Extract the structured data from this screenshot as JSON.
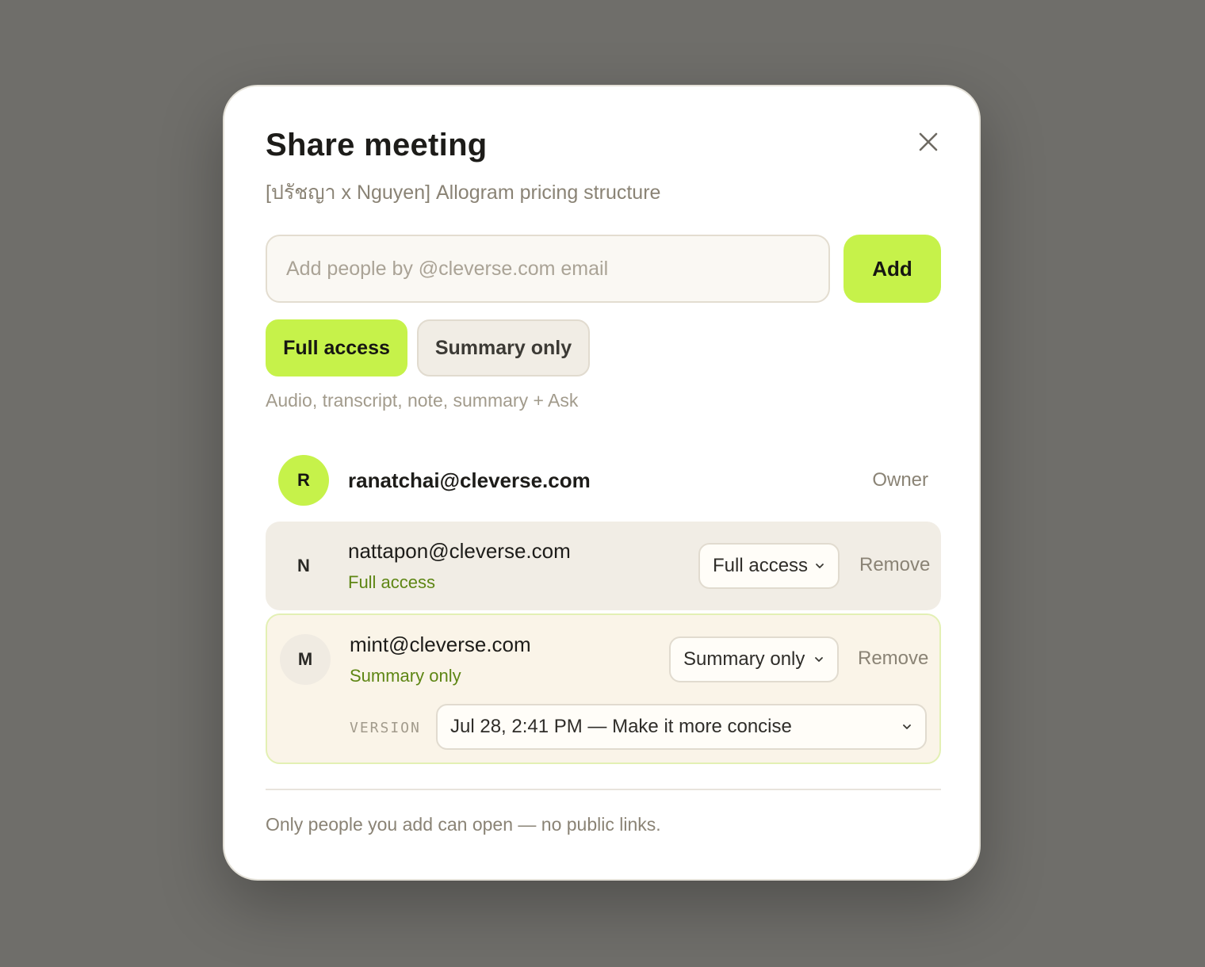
{
  "modal": {
    "title": "Share meeting",
    "subtitle": "[ปรัชญา x Nguyen] Allogram pricing structure",
    "close_icon": "close-icon"
  },
  "invite": {
    "placeholder": "Add people by @cleverse.com email",
    "value": "",
    "add_label": "Add"
  },
  "access_options": {
    "full_label": "Full access",
    "summary_label": "Summary only",
    "selected": "Full access",
    "description": "Audio, transcript, note, summary + Ask"
  },
  "owner": {
    "initial": "R",
    "email": "ranatchai@cleverse.com",
    "role": "Owner"
  },
  "members": [
    {
      "initial": "N",
      "email": "nattapon@cleverse.com",
      "access": "Full access",
      "dropdown_value": "Full access",
      "remove_label": "Remove"
    },
    {
      "initial": "M",
      "email": "mint@cleverse.com",
      "access": "Summary only",
      "dropdown_value": "Summary only",
      "remove_label": "Remove",
      "version_label": "VERSION",
      "version_value": "Jul 28, 2:41 PM — Make it more concise"
    }
  ],
  "footer": {
    "note": "Only people you add can open — no public links."
  },
  "colors": {
    "accent": "#c6f24a",
    "access_text": "#5e8614",
    "backdrop": "#6f6e6a"
  }
}
